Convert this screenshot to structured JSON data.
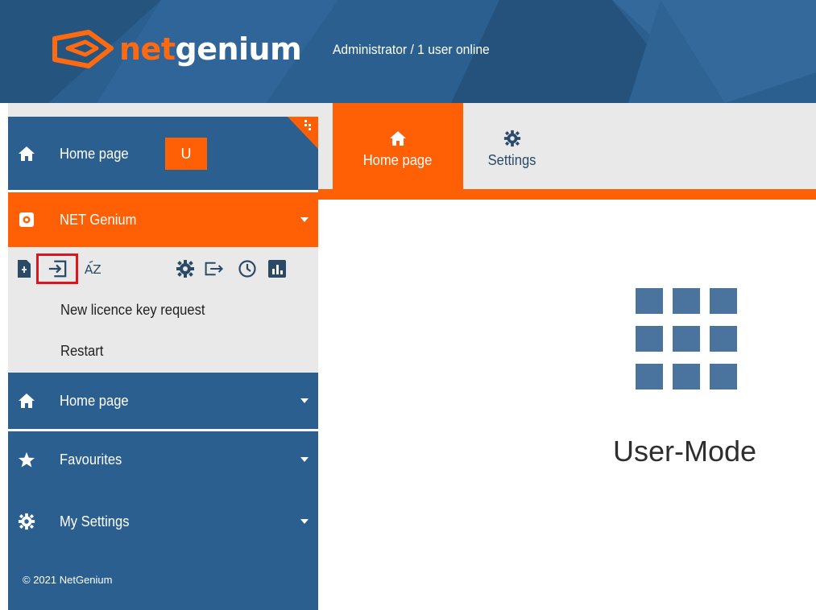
{
  "header": {
    "logo_net": "net",
    "logo_genium": "genium",
    "user_status": "Administrator / 1 user online"
  },
  "sidebar": {
    "home_page": "Home page",
    "user_badge": "U",
    "net_genium": "NET Genium",
    "submenu": [
      "New licence key request",
      "Restart"
    ],
    "home_page_section": "Home page",
    "favourites": "Favourites",
    "my_settings": "My Settings",
    "footer": "© 2021 NetGenium",
    "toolbar_icons": [
      "new-document-icon",
      "import-icon",
      "sort-az-icon",
      "gear-icon",
      "export-icon",
      "clock-icon",
      "chart-icon"
    ]
  },
  "tabs": [
    {
      "label": "Home page",
      "icon": "home-icon",
      "active": true
    },
    {
      "label": "Settings",
      "icon": "gear-icon",
      "active": false
    }
  ],
  "main": {
    "mode_label": "User-Mode",
    "mode_icon": "grid-icon"
  },
  "colors": {
    "primary_blue": "#2b5f8f",
    "accent_orange": "#ff6005",
    "highlight_red": "#e0141e"
  }
}
